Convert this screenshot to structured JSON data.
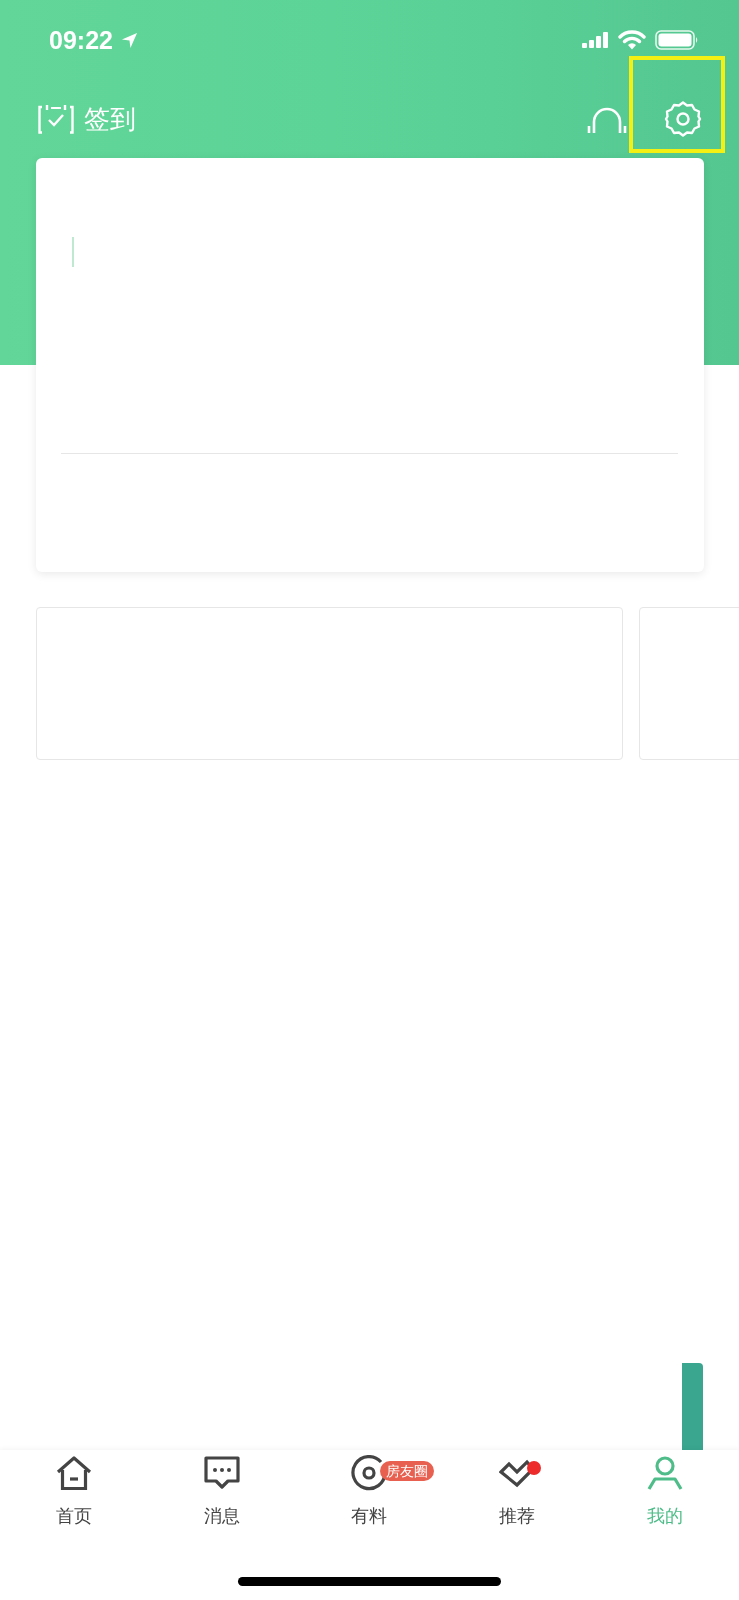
{
  "status_bar": {
    "time": "09:22"
  },
  "header": {
    "checkin_label": "签到",
    "settings_highlighted": true
  },
  "tab_bar": {
    "items": [
      {
        "label": "首页",
        "selected": false,
        "dot": false
      },
      {
        "label": "消息",
        "selected": false,
        "dot": false
      },
      {
        "label": "有料",
        "selected": false,
        "dot": false,
        "badge": "房友圈"
      },
      {
        "label": "推荐",
        "selected": false,
        "dot": true
      },
      {
        "label": "我的",
        "selected": true,
        "dot": false
      }
    ]
  }
}
